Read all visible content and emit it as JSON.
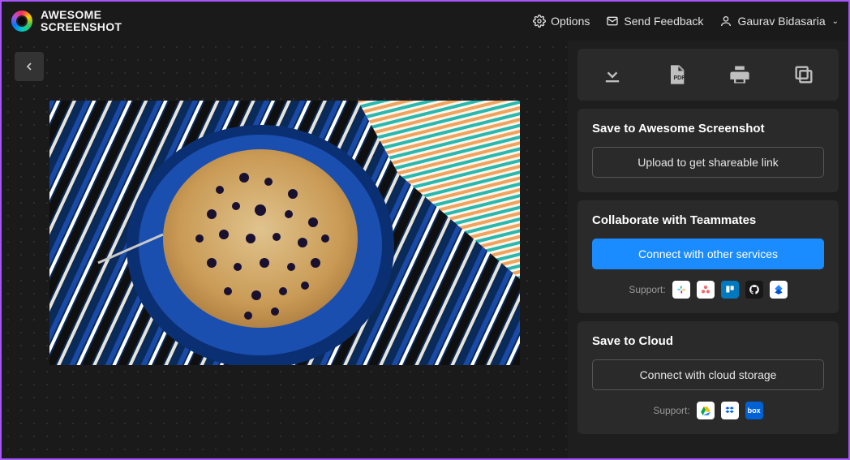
{
  "header": {
    "app_name_line1": "AWESOME",
    "app_name_line2": "SCREENSHOT",
    "options_label": "Options",
    "feedback_label": "Send Feedback",
    "user_name": "Gaurav Bidasaria"
  },
  "toolbar": {
    "download": "download-icon",
    "pdf": "pdf-icon",
    "print": "print-icon",
    "copy": "copy-icon"
  },
  "panels": {
    "save_as": {
      "title": "Save to Awesome Screenshot",
      "button": "Upload to get shareable link"
    },
    "collaborate": {
      "title": "Collaborate with Teammates",
      "button": "Connect with other services",
      "support_label": "Support:",
      "services": [
        "slack",
        "asana",
        "trello",
        "github",
        "jira"
      ]
    },
    "cloud": {
      "title": "Save to Cloud",
      "button": "Connect with cloud storage",
      "support_label": "Support:",
      "services": [
        "gdrive",
        "dropbox",
        "box"
      ]
    }
  }
}
